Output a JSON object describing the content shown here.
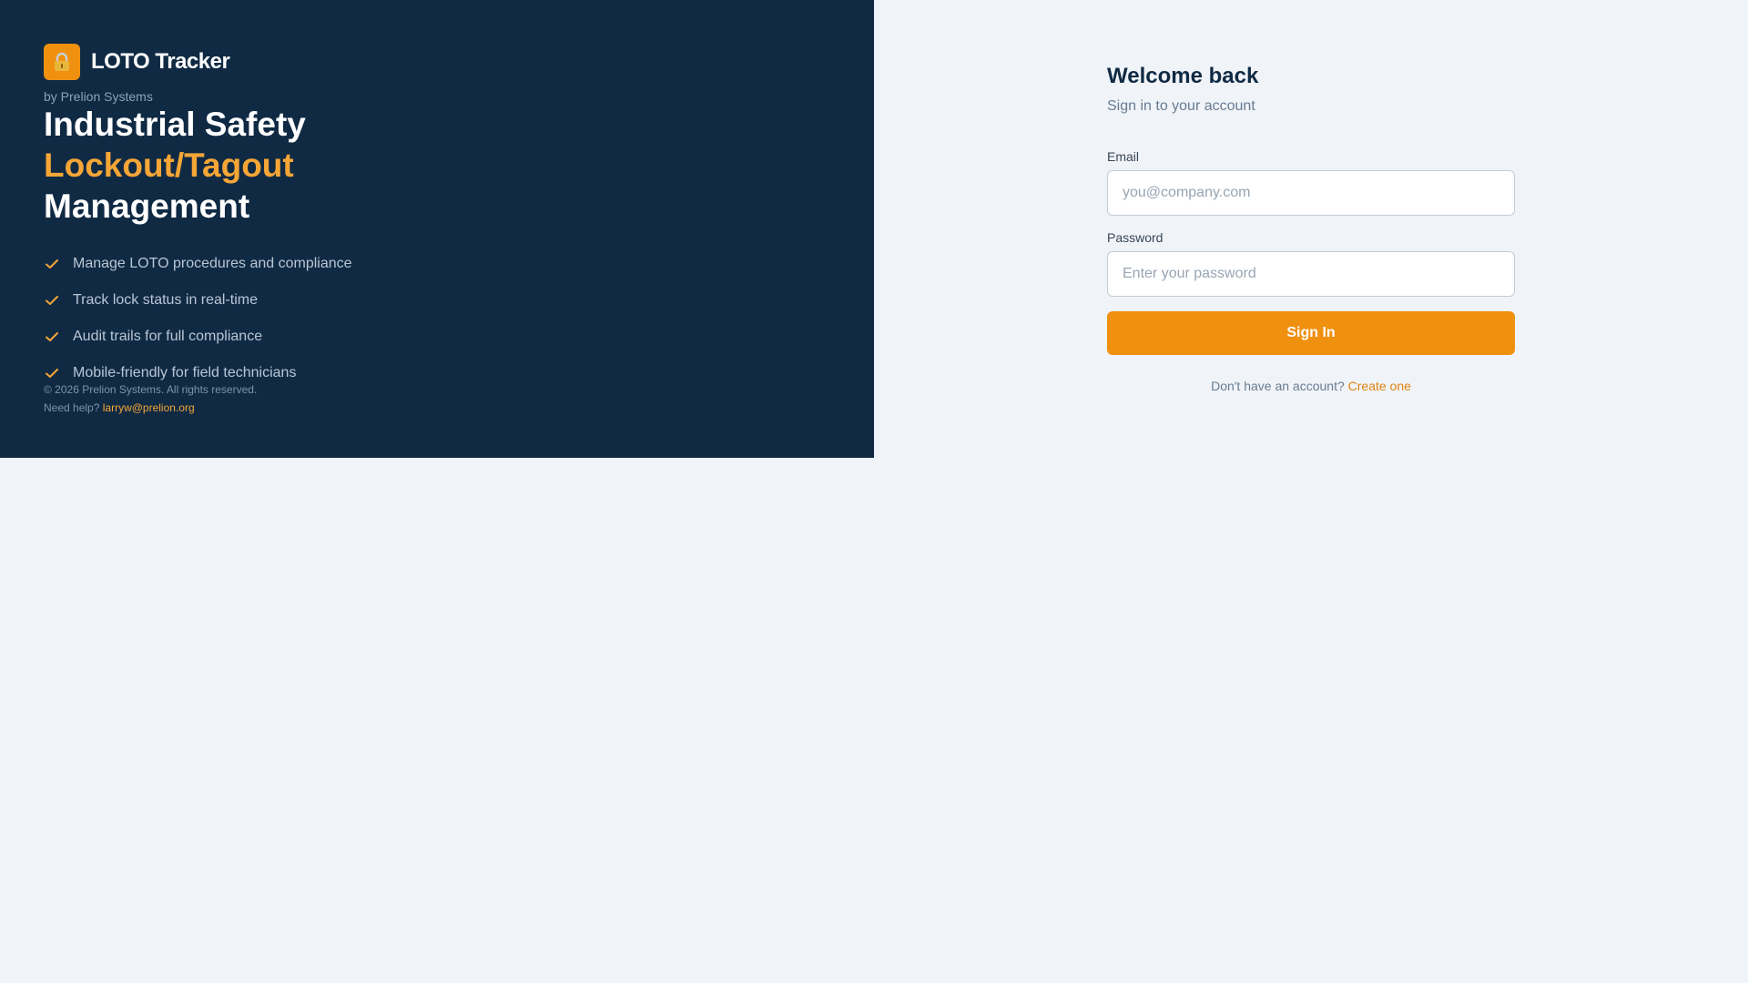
{
  "brand": {
    "app_name": "LOTO Tracker",
    "byline": "by Prelion Systems",
    "logo_icon": "lock-icon"
  },
  "hero": {
    "headline_line1": "Industrial Safety",
    "headline_line2": "Lockout/Tagout",
    "headline_line3": "Management"
  },
  "features": [
    "Manage LOTO procedures and compliance",
    "Track lock status in real-time",
    "Audit trails for full compliance",
    "Mobile-friendly for field technicians"
  ],
  "footer": {
    "copyright": "© 2026 Prelion Systems. All rights reserved.",
    "help_prefix": "Need help?",
    "help_email": "larryw@prelion.org"
  },
  "signin": {
    "title": "Welcome back",
    "subtitle": "Sign in to your account",
    "email_label": "Email",
    "email_placeholder": "you@company.com",
    "password_label": "Password",
    "password_placeholder": "Enter your password",
    "submit_label": "Sign In",
    "signup_prompt": "Don't have an account?",
    "signup_link": "Create one"
  },
  "colors": {
    "panel_bg": "#102a44",
    "accent": "#f0900f",
    "accent_text": "#f5a636",
    "page_bg": "#f0f3f7"
  }
}
